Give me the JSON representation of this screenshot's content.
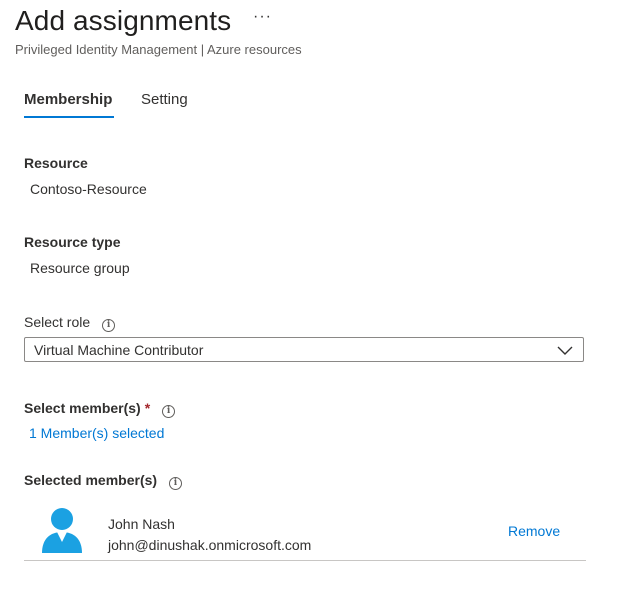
{
  "header": {
    "title": "Add assignments",
    "more_label": "···",
    "subtitle": "Privileged Identity Management | Azure resources"
  },
  "tabs": [
    {
      "label": "Membership",
      "selected": true
    },
    {
      "label": "Setting",
      "selected": false
    }
  ],
  "resource": {
    "label": "Resource",
    "value": "Contoso-Resource"
  },
  "resource_type": {
    "label": "Resource type",
    "value": "Resource group"
  },
  "role": {
    "label": "Select role",
    "selected_value": "Virtual Machine Contributor"
  },
  "members": {
    "label": "Select member(s)",
    "required_mark": "*",
    "selected_link": "1 Member(s) selected"
  },
  "selected_members": {
    "label": "Selected member(s)",
    "items": [
      {
        "name": "John Nash",
        "email": "john@dinushak.onmicrosoft.com",
        "remove_label": "Remove"
      }
    ]
  },
  "icons": {
    "info": "i"
  },
  "colors": {
    "accent": "#0078d4",
    "required": "#a4262c",
    "avatar": "#1ba1e2"
  }
}
